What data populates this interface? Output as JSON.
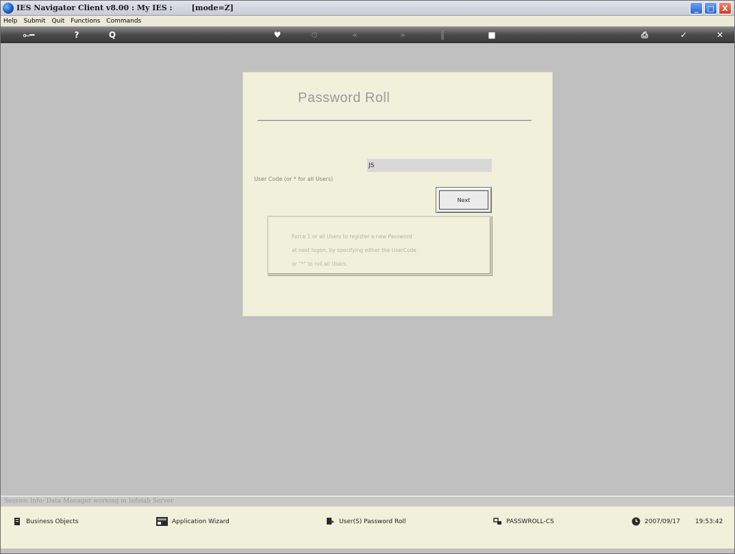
{
  "window": {
    "title": "IES Navigator Client v8.00 : My IES :",
    "mode": "[mode=Z]",
    "controls": {
      "minimize": "_",
      "maximize": "□",
      "close": "X"
    }
  },
  "menu": {
    "items": [
      "Help",
      "Submit",
      "Quit",
      "Functions",
      "Commands"
    ]
  },
  "toolbar": {
    "icons": [
      "key-icon",
      "help-icon",
      "search-icon",
      "heart-icon",
      "refresh-icon",
      "previous-icon",
      "next-icon",
      "pause-icon",
      "stop-icon",
      "print-icon",
      "ok-icon",
      "close-icon"
    ],
    "glyphs": {
      "key": "⟜━",
      "help": "?",
      "search": "Q",
      "heart": "♥",
      "refresh": "⏱",
      "previous": "«",
      "next": "»",
      "pause": "‖",
      "stop": "■",
      "print": "⎙",
      "ok": "✓",
      "close": "✕"
    }
  },
  "form": {
    "title": "Password Roll",
    "user_code_label": "User Code (or * for all Users)",
    "user_code_value": "JS",
    "next_label": "Next",
    "info_lines": [
      "Force 1 or all Users to register a new Password",
      "at next logon, by specifying either the UserCode",
      "or \"*\" to roll all Users."
    ]
  },
  "session": {
    "info": "Session Info: Data Manager working in Infolab Server"
  },
  "statusbar": {
    "business_objects": "Business Objects",
    "application_wizard": "Application Wizard",
    "current_function": "User(S) Password Roll",
    "program_code": "PASSWROLL-CS",
    "date": "2007/09/17",
    "time": "19:53:42"
  }
}
